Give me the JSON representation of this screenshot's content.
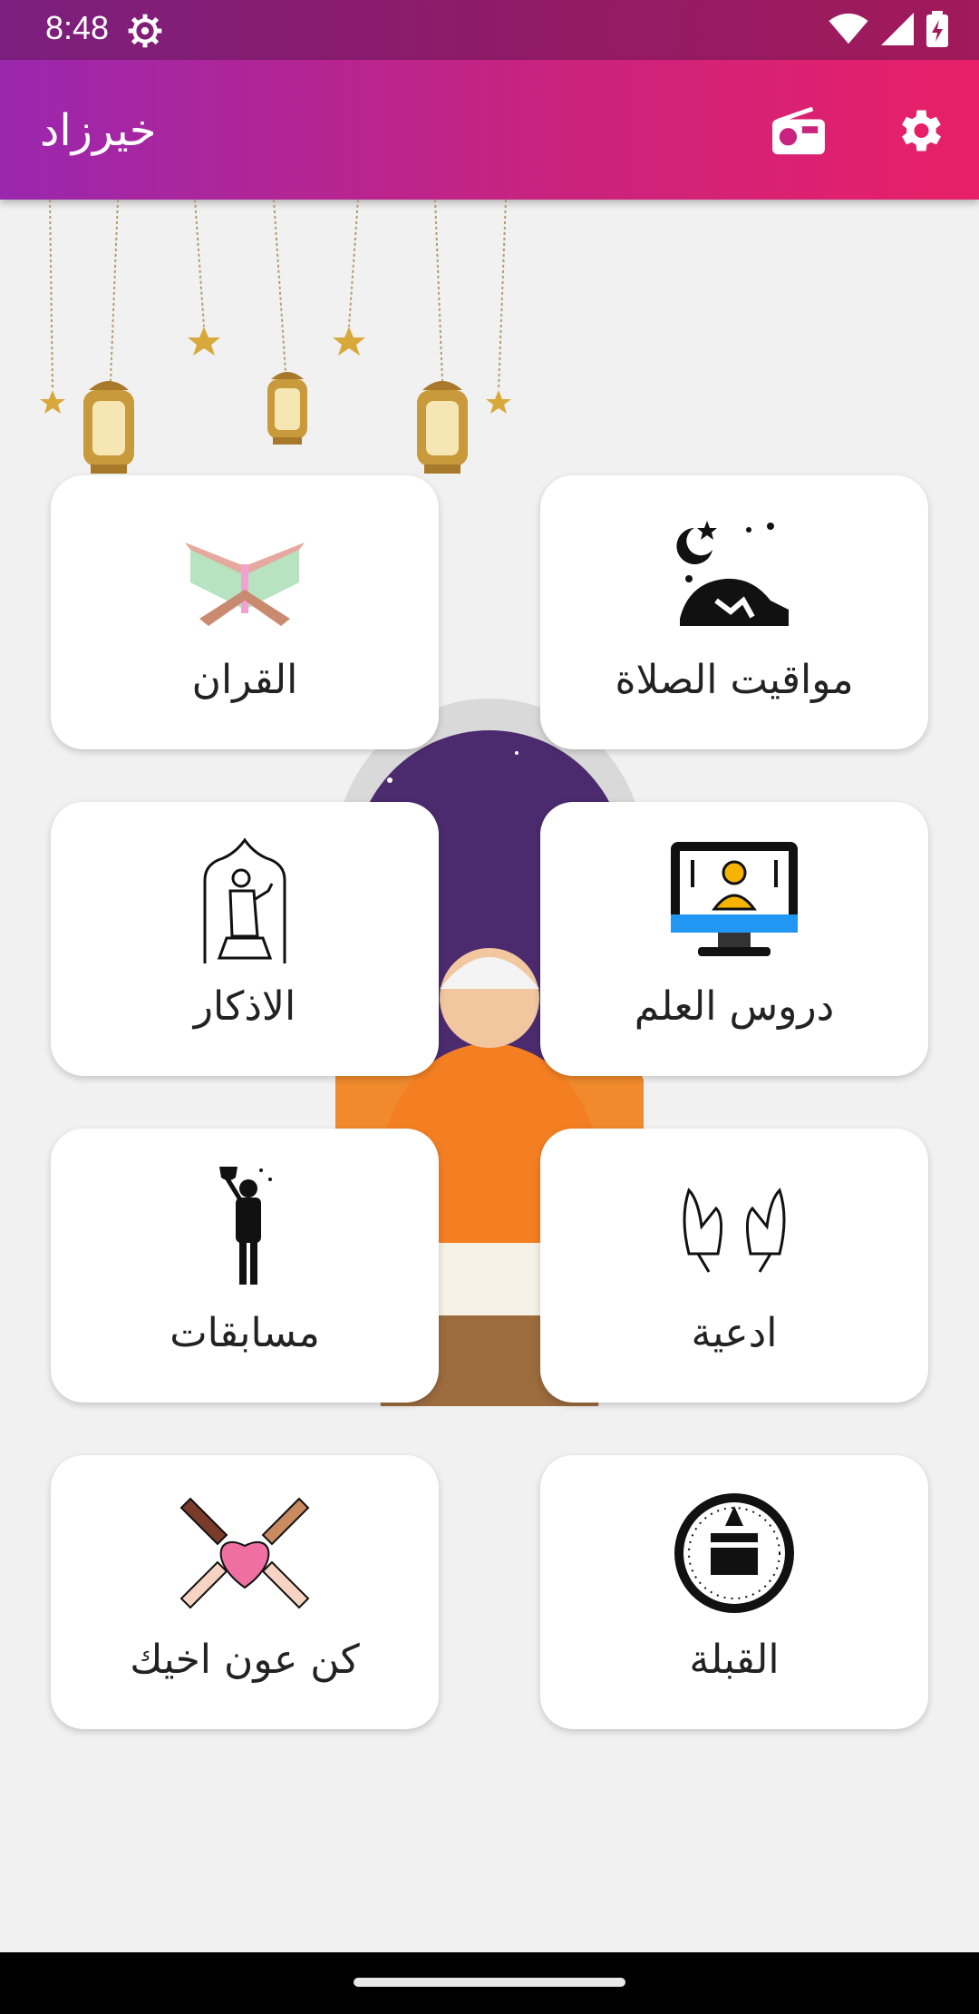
{
  "status": {
    "time": "8:48"
  },
  "appbar": {
    "title": "خيرزاد"
  },
  "cards": [
    {
      "label": "القران",
      "icon": "quran-icon"
    },
    {
      "label": "مواقيت الصلاة",
      "icon": "prayer-times-icon"
    },
    {
      "label": "الاذكار",
      "icon": "adhkar-icon"
    },
    {
      "label": "دروس العلم",
      "icon": "lessons-icon"
    },
    {
      "label": "مسابقات",
      "icon": "competitions-icon"
    },
    {
      "label": "ادعية",
      "icon": "duaa-icon"
    },
    {
      "label": "كن عون اخيك",
      "icon": "helping-hands-icon"
    },
    {
      "label": "القبلة",
      "icon": "qibla-icon"
    }
  ],
  "colors": {
    "accent_start": "#9a27ae",
    "accent_end": "#e81f68",
    "background": "#f1f1f1"
  }
}
